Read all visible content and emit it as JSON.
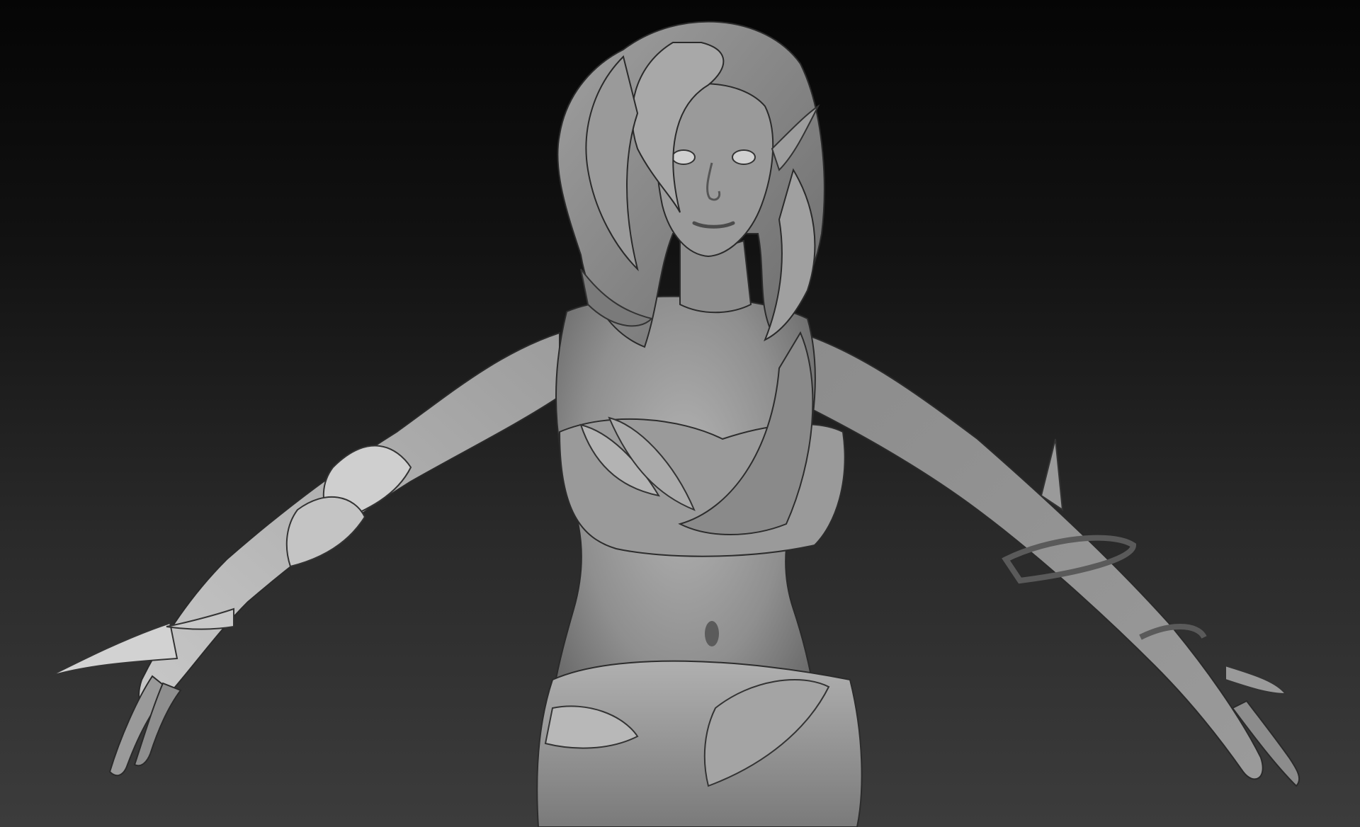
{
  "viewport": {
    "background_top": "#050505",
    "background_bottom": "#3c3c3c",
    "material_color": "#8f8f8f",
    "material_highlight": "#d6d6d6",
    "material_shadow": "#3a3a3a"
  },
  "model": {
    "icon": "sculpt-model-icon"
  }
}
